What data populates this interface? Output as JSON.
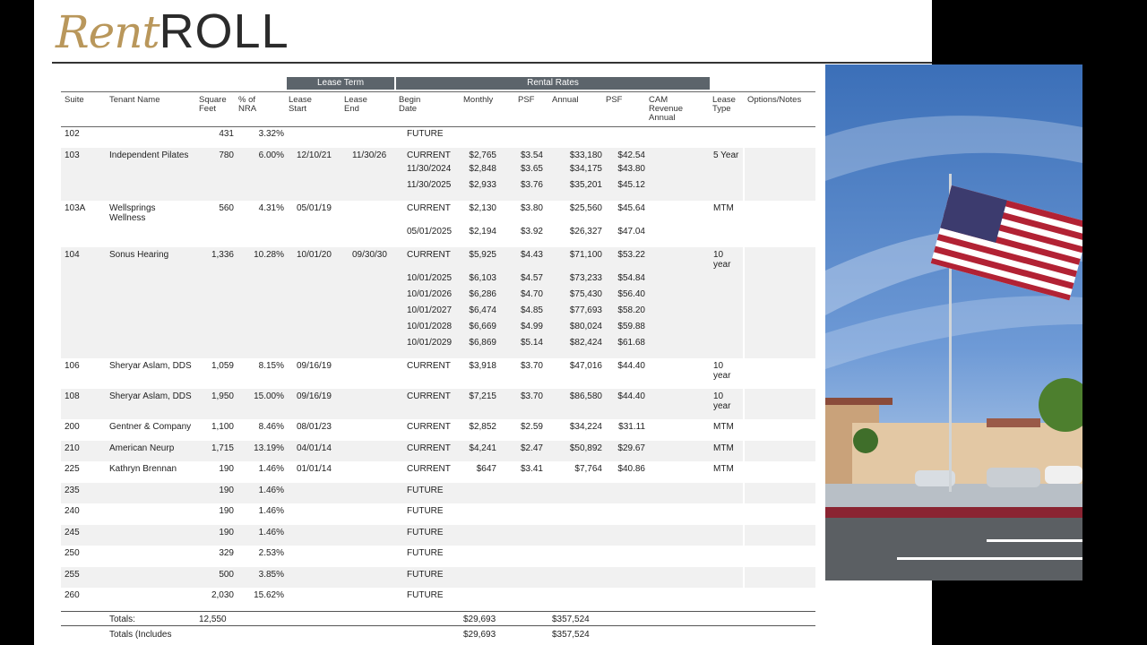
{
  "logo": {
    "script": "Rent",
    "word": "ROLL"
  },
  "groups": {
    "lease_term": "Lease Term",
    "rental_rates": "Rental Rates"
  },
  "columns": {
    "suite": "Suite",
    "tenant": "Tenant Name",
    "sqft": "Square\nFeet",
    "nra": "% of\nNRA",
    "lease_start": "Lease\nStart",
    "lease_end": "Lease\nEnd",
    "begin": "Begin\nDate",
    "monthly": "Monthly",
    "psf1": "PSF",
    "annual": "Annual",
    "psf2": "PSF",
    "cam": "CAM\nRevenue\nAnnual",
    "lease_type": "Lease\nType",
    "options": "Options/Notes"
  },
  "rows": [
    {
      "suite": "102",
      "tenant": "",
      "sqft": "431",
      "nra": "3.32%",
      "start": "",
      "end": "",
      "lines": [
        {
          "begin": "FUTURE",
          "monthly": "",
          "psf": "",
          "annual": "",
          "psf2": ""
        }
      ],
      "type": ""
    },
    {
      "suite": "103",
      "tenant": "Independent Pilates",
      "sqft": "780",
      "nra": "6.00%",
      "start": "12/10/21",
      "end": "11/30/26",
      "lines": [
        {
          "begin": "CURRENT",
          "monthly": "$2,765",
          "psf": "$3.54",
          "annual": "$33,180",
          "psf2": "$42.54"
        },
        {
          "begin": "11/30/2024",
          "monthly": "$2,848",
          "psf": "$3.65",
          "annual": "$34,175",
          "psf2": "$43.80"
        },
        {
          "begin": "11/30/2025",
          "monthly": "$2,933",
          "psf": "$3.76",
          "annual": "$35,201",
          "psf2": "$45.12"
        }
      ],
      "type": "5 Year"
    },
    {
      "suite": "103A",
      "tenant": "Wellsprings\nWellness",
      "sqft": "560",
      "nra": "4.31%",
      "start": "05/01/19",
      "end": "",
      "lines": [
        {
          "begin": "CURRENT",
          "monthly": "$2,130",
          "psf": "$3.80",
          "annual": "$25,560",
          "psf2": "$45.64"
        },
        {
          "begin": "05/01/2025",
          "monthly": "$2,194",
          "psf": "$3.92",
          "annual": "$26,327",
          "psf2": "$47.04"
        }
      ],
      "type": "MTM"
    },
    {
      "suite": "104",
      "tenant": "Sonus Hearing",
      "sqft": "1,336",
      "nra": "10.28%",
      "start": "10/01/20",
      "end": "09/30/30",
      "lines": [
        {
          "begin": "CURRENT",
          "monthly": "$5,925",
          "psf": "$4.43",
          "annual": "$71,100",
          "psf2": "$53.22"
        },
        {
          "begin": "10/01/2025",
          "monthly": "$6,103",
          "psf": "$4.57",
          "annual": "$73,233",
          "psf2": "$54.84"
        },
        {
          "begin": "10/01/2026",
          "monthly": "$6,286",
          "psf": "$4.70",
          "annual": "$75,430",
          "psf2": "$56.40"
        },
        {
          "begin": "10/01/2027",
          "monthly": "$6,474",
          "psf": "$4.85",
          "annual": "$77,693",
          "psf2": "$58.20"
        },
        {
          "begin": "10/01/2028",
          "monthly": "$6,669",
          "psf": "$4.99",
          "annual": "$80,024",
          "psf2": "$59.88"
        },
        {
          "begin": "10/01/2029",
          "monthly": "$6,869",
          "psf": "$5.14",
          "annual": "$82,424",
          "psf2": "$61.68"
        }
      ],
      "type": "10\nyear"
    },
    {
      "suite": "106",
      "tenant": "Sheryar Aslam, DDS",
      "sqft": "1,059",
      "nra": "8.15%",
      "start": "09/16/19",
      "end": "",
      "lines": [
        {
          "begin": "CURRENT",
          "monthly": "$3,918",
          "psf": "$3.70",
          "annual": "$47,016",
          "psf2": "$44.40"
        }
      ],
      "type": "10\nyear"
    },
    {
      "suite": "108",
      "tenant": "Sheryar Aslam, DDS",
      "sqft": "1,950",
      "nra": "15.00%",
      "start": "09/16/19",
      "end": "",
      "lines": [
        {
          "begin": "CURRENT",
          "monthly": "$7,215",
          "psf": "$3.70",
          "annual": "$86,580",
          "psf2": "$44.40"
        }
      ],
      "type": "10\nyear"
    },
    {
      "suite": "200",
      "tenant": "Gentner & Company",
      "sqft": "1,100",
      "nra": "8.46%",
      "start": "08/01/23",
      "end": "",
      "lines": [
        {
          "begin": "CURRENT",
          "monthly": "$2,852",
          "psf": "$2.59",
          "annual": "$34,224",
          "psf2": "$31.11"
        }
      ],
      "type": "MTM"
    },
    {
      "suite": "210",
      "tenant": "American Neurp",
      "sqft": "1,715",
      "nra": "13.19%",
      "start": "04/01/14",
      "end": "",
      "lines": [
        {
          "begin": "CURRENT",
          "monthly": "$4,241",
          "psf": "$2.47",
          "annual": "$50,892",
          "psf2": "$29.67"
        }
      ],
      "type": "MTM"
    },
    {
      "suite": "225",
      "tenant": "Kathryn Brennan",
      "sqft": "190",
      "nra": "1.46%",
      "start": "01/01/14",
      "end": "",
      "lines": [
        {
          "begin": "CURRENT",
          "monthly": "$647",
          "psf": "$3.41",
          "annual": "$7,764",
          "psf2": "$40.86"
        }
      ],
      "type": "MTM"
    },
    {
      "suite": "235",
      "tenant": "",
      "sqft": "190",
      "nra": "1.46%",
      "start": "",
      "end": "",
      "lines": [
        {
          "begin": "FUTURE",
          "monthly": "",
          "psf": "",
          "annual": "",
          "psf2": ""
        }
      ],
      "type": ""
    },
    {
      "suite": "240",
      "tenant": "",
      "sqft": "190",
      "nra": "1.46%",
      "start": "",
      "end": "",
      "lines": [
        {
          "begin": "FUTURE",
          "monthly": "",
          "psf": "",
          "annual": "",
          "psf2": ""
        }
      ],
      "type": ""
    },
    {
      "suite": "245",
      "tenant": "",
      "sqft": "190",
      "nra": "1.46%",
      "start": "",
      "end": "",
      "lines": [
        {
          "begin": "FUTURE",
          "monthly": "",
          "psf": "",
          "annual": "",
          "psf2": ""
        }
      ],
      "type": ""
    },
    {
      "suite": "250",
      "tenant": "",
      "sqft": "329",
      "nra": "2.53%",
      "start": "",
      "end": "",
      "lines": [
        {
          "begin": "FUTURE",
          "monthly": "",
          "psf": "",
          "annual": "",
          "psf2": ""
        }
      ],
      "type": ""
    },
    {
      "suite": "255",
      "tenant": "",
      "sqft": "500",
      "nra": "3.85%",
      "start": "",
      "end": "",
      "lines": [
        {
          "begin": "FUTURE",
          "monthly": "",
          "psf": "",
          "annual": "",
          "psf2": ""
        }
      ],
      "type": ""
    },
    {
      "suite": "260",
      "tenant": "",
      "sqft": "2,030",
      "nra": "15.62%",
      "start": "",
      "end": "",
      "lines": [
        {
          "begin": "FUTURE",
          "monthly": "",
          "psf": "",
          "annual": "",
          "psf2": ""
        }
      ],
      "type": ""
    }
  ],
  "totals": [
    {
      "label": "Totals:",
      "sqft": "12,550",
      "monthly": "$29,693",
      "annual": "$357,524"
    },
    {
      "label": "Totals (Includes",
      "sqft": "",
      "monthly": "$29,693",
      "annual": "$357,524"
    }
  ]
}
